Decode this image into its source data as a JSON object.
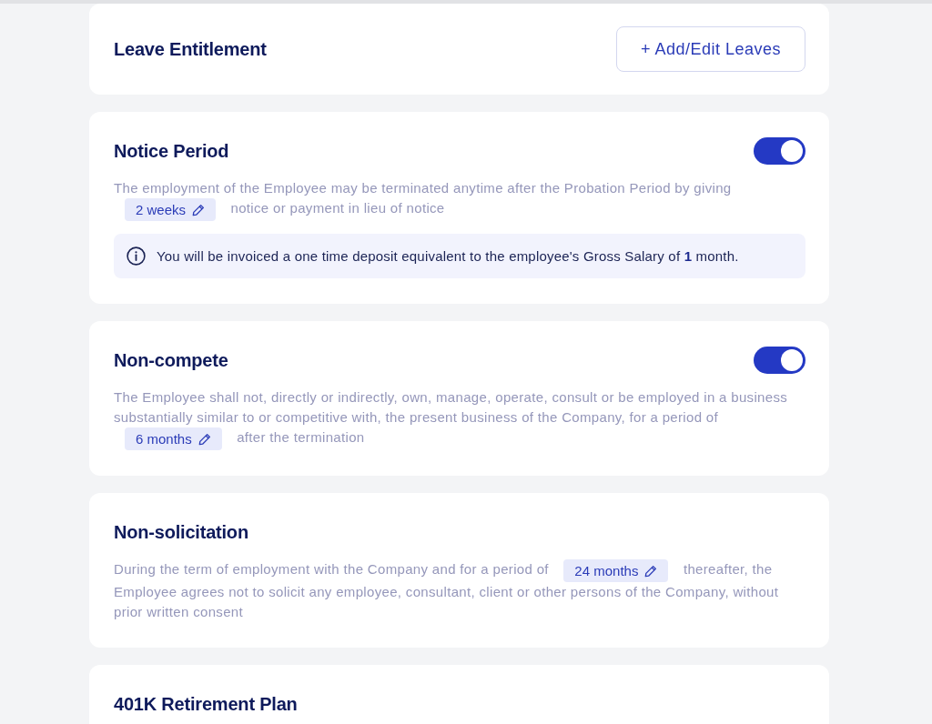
{
  "sections": [
    {
      "title": "Leave Entitlement",
      "action": "+ Add/Edit Leaves"
    },
    {
      "title": "Notice Period",
      "toggle": {
        "on": true
      },
      "clause": {
        "before": "The employment of the Employee may be terminated anytime after the Probation Period by giving",
        "value": "2 weeks",
        "after": "notice or payment in lieu of notice"
      },
      "note": "You will be invoiced a one time deposit equivalent to the employee's Gross Salary of **1** month."
    },
    {
      "title": "Non-compete",
      "toggle": {
        "on": true
      },
      "clause": {
        "before": "The Employee shall not, directly or indirectly, own, manage, operate, consult or be employed in a business substantially similar to or competitive with, the present business of the Company, for a period of",
        "value": "6 months",
        "after": "after the termination"
      }
    },
    {
      "title": "Non-solicitation",
      "clause": {
        "before": "During the term of employment with the Company and for a period of",
        "value": "24 months",
        "after": "thereafter, the Employee agrees not to solicit any employee, consultant, client or other persons of the Company, without prior written consent"
      }
    },
    {
      "title": "401K Retirement Plan"
    }
  ]
}
